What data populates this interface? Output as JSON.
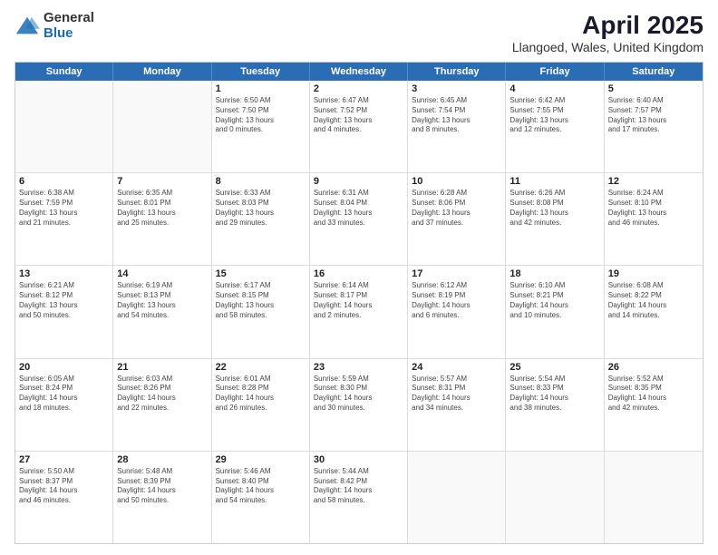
{
  "header": {
    "logo": {
      "general": "General",
      "blue": "Blue"
    },
    "title": "April 2025",
    "subtitle": "Llangoed, Wales, United Kingdom"
  },
  "calendar": {
    "days": [
      "Sunday",
      "Monday",
      "Tuesday",
      "Wednesday",
      "Thursday",
      "Friday",
      "Saturday"
    ],
    "rows": [
      [
        {
          "day": "",
          "content": ""
        },
        {
          "day": "",
          "content": ""
        },
        {
          "day": "1",
          "content": "Sunrise: 6:50 AM\nSunset: 7:50 PM\nDaylight: 13 hours\nand 0 minutes."
        },
        {
          "day": "2",
          "content": "Sunrise: 6:47 AM\nSunset: 7:52 PM\nDaylight: 13 hours\nand 4 minutes."
        },
        {
          "day": "3",
          "content": "Sunrise: 6:45 AM\nSunset: 7:54 PM\nDaylight: 13 hours\nand 8 minutes."
        },
        {
          "day": "4",
          "content": "Sunrise: 6:42 AM\nSunset: 7:55 PM\nDaylight: 13 hours\nand 12 minutes."
        },
        {
          "day": "5",
          "content": "Sunrise: 6:40 AM\nSunset: 7:57 PM\nDaylight: 13 hours\nand 17 minutes."
        }
      ],
      [
        {
          "day": "6",
          "content": "Sunrise: 6:38 AM\nSunset: 7:59 PM\nDaylight: 13 hours\nand 21 minutes."
        },
        {
          "day": "7",
          "content": "Sunrise: 6:35 AM\nSunset: 8:01 PM\nDaylight: 13 hours\nand 25 minutes."
        },
        {
          "day": "8",
          "content": "Sunrise: 6:33 AM\nSunset: 8:03 PM\nDaylight: 13 hours\nand 29 minutes."
        },
        {
          "day": "9",
          "content": "Sunrise: 6:31 AM\nSunset: 8:04 PM\nDaylight: 13 hours\nand 33 minutes."
        },
        {
          "day": "10",
          "content": "Sunrise: 6:28 AM\nSunset: 8:06 PM\nDaylight: 13 hours\nand 37 minutes."
        },
        {
          "day": "11",
          "content": "Sunrise: 6:26 AM\nSunset: 8:08 PM\nDaylight: 13 hours\nand 42 minutes."
        },
        {
          "day": "12",
          "content": "Sunrise: 6:24 AM\nSunset: 8:10 PM\nDaylight: 13 hours\nand 46 minutes."
        }
      ],
      [
        {
          "day": "13",
          "content": "Sunrise: 6:21 AM\nSunset: 8:12 PM\nDaylight: 13 hours\nand 50 minutes."
        },
        {
          "day": "14",
          "content": "Sunrise: 6:19 AM\nSunset: 8:13 PM\nDaylight: 13 hours\nand 54 minutes."
        },
        {
          "day": "15",
          "content": "Sunrise: 6:17 AM\nSunset: 8:15 PM\nDaylight: 13 hours\nand 58 minutes."
        },
        {
          "day": "16",
          "content": "Sunrise: 6:14 AM\nSunset: 8:17 PM\nDaylight: 14 hours\nand 2 minutes."
        },
        {
          "day": "17",
          "content": "Sunrise: 6:12 AM\nSunset: 8:19 PM\nDaylight: 14 hours\nand 6 minutes."
        },
        {
          "day": "18",
          "content": "Sunrise: 6:10 AM\nSunset: 8:21 PM\nDaylight: 14 hours\nand 10 minutes."
        },
        {
          "day": "19",
          "content": "Sunrise: 6:08 AM\nSunset: 8:22 PM\nDaylight: 14 hours\nand 14 minutes."
        }
      ],
      [
        {
          "day": "20",
          "content": "Sunrise: 6:05 AM\nSunset: 8:24 PM\nDaylight: 14 hours\nand 18 minutes."
        },
        {
          "day": "21",
          "content": "Sunrise: 6:03 AM\nSunset: 8:26 PM\nDaylight: 14 hours\nand 22 minutes."
        },
        {
          "day": "22",
          "content": "Sunrise: 6:01 AM\nSunset: 8:28 PM\nDaylight: 14 hours\nand 26 minutes."
        },
        {
          "day": "23",
          "content": "Sunrise: 5:59 AM\nSunset: 8:30 PM\nDaylight: 14 hours\nand 30 minutes."
        },
        {
          "day": "24",
          "content": "Sunrise: 5:57 AM\nSunset: 8:31 PM\nDaylight: 14 hours\nand 34 minutes."
        },
        {
          "day": "25",
          "content": "Sunrise: 5:54 AM\nSunset: 8:33 PM\nDaylight: 14 hours\nand 38 minutes."
        },
        {
          "day": "26",
          "content": "Sunrise: 5:52 AM\nSunset: 8:35 PM\nDaylight: 14 hours\nand 42 minutes."
        }
      ],
      [
        {
          "day": "27",
          "content": "Sunrise: 5:50 AM\nSunset: 8:37 PM\nDaylight: 14 hours\nand 46 minutes."
        },
        {
          "day": "28",
          "content": "Sunrise: 5:48 AM\nSunset: 8:39 PM\nDaylight: 14 hours\nand 50 minutes."
        },
        {
          "day": "29",
          "content": "Sunrise: 5:46 AM\nSunset: 8:40 PM\nDaylight: 14 hours\nand 54 minutes."
        },
        {
          "day": "30",
          "content": "Sunrise: 5:44 AM\nSunset: 8:42 PM\nDaylight: 14 hours\nand 58 minutes."
        },
        {
          "day": "",
          "content": ""
        },
        {
          "day": "",
          "content": ""
        },
        {
          "day": "",
          "content": ""
        }
      ]
    ]
  }
}
